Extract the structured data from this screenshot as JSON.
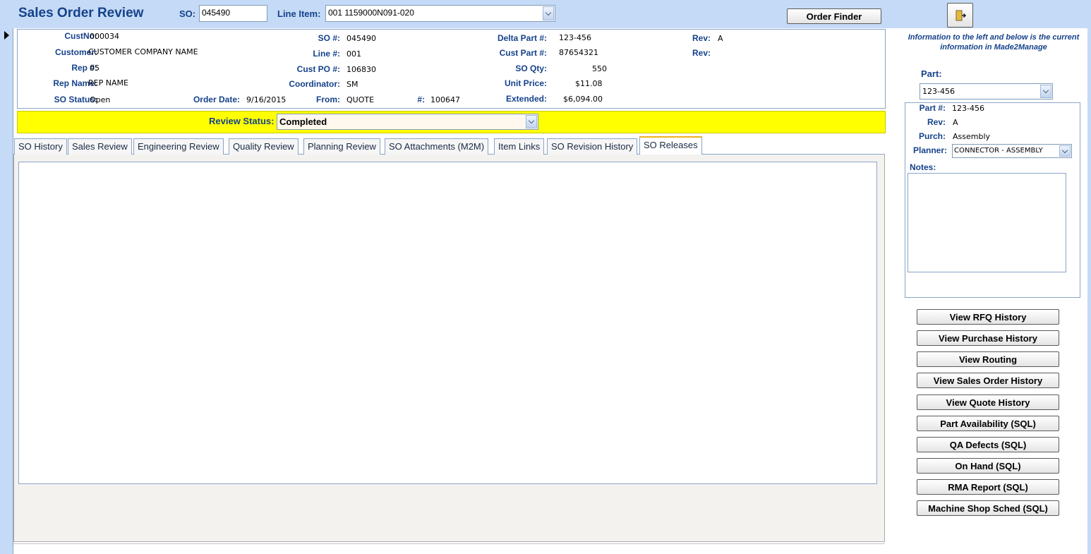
{
  "header": {
    "title": "Sales Order Review",
    "so_label": "SO:",
    "so_value": "045490",
    "line_item_label": "Line Item:",
    "line_item_value": "001 1159000N091-020",
    "order_finder_label": "Order Finder",
    "exit_icon": "exit-door-icon"
  },
  "info": {
    "custno_label": "CustNo:",
    "custno": "000034",
    "customer_label": "Customer:",
    "customer": "CUSTOMER COMPANY NAME",
    "rep_label": "Rep #:",
    "rep": "05",
    "rep_name_label": "Rep Name:",
    "rep_name": "REP NAME",
    "so_status_label": "SO Status:",
    "so_status": "Open",
    "order_date_label": "Order Date:",
    "order_date": "9/16/2015",
    "so_num_label": "SO #:",
    "so_num": "045490",
    "line_num_label": "Line #:",
    "line_num": "001",
    "cust_po_label": "Cust PO #:",
    "cust_po": "106830",
    "coordinator_label": "Coordinator:",
    "coordinator": "SM",
    "from_label": "From:",
    "from": "QUOTE",
    "from_num_label": "#:",
    "from_num": "100647",
    "delta_part_label": "Delta Part #:",
    "delta_part": "123-456",
    "cust_part_label": "Cust Part #:",
    "cust_part": "87654321",
    "so_qty_label": "SO Qty:",
    "so_qty": "550",
    "unit_price_label": "Unit Price:",
    "unit_price": "$11.08",
    "extended_label": "Extended:",
    "extended": "$6,094.00",
    "rev1_label": "Rev:",
    "rev1": "A",
    "rev2_label": "Rev:",
    "rev2": ""
  },
  "review": {
    "label": "Review Status:",
    "value": "Completed"
  },
  "tabs": [
    {
      "label": "SO History"
    },
    {
      "label": "Sales Review"
    },
    {
      "label": "Engineering Review"
    },
    {
      "label": "Quality Review"
    },
    {
      "label": "Planning Review"
    },
    {
      "label": "SO Attachments (M2M)"
    },
    {
      "label": "Item Links"
    },
    {
      "label": "SO Revision History"
    },
    {
      "label": "SO Releases"
    }
  ],
  "active_tab": "SO Releases",
  "right": {
    "note": "Information to the left and below is the current information in Made2Manage",
    "part_label": "Part:",
    "part_value": "123-456",
    "part_num_label": "Part #:",
    "part_num": "123-456",
    "rev_label": "Rev:",
    "rev": "A",
    "purch_label": "Purch:",
    "purch": "Assembly",
    "planner_label": "Planner:",
    "planner": "CONNECTOR - ASSEMBLY",
    "notes_label": "Notes:",
    "notes": ""
  },
  "buttons": [
    {
      "label": "View RFQ History"
    },
    {
      "label": "View Purchase History"
    },
    {
      "label": "View Routing"
    },
    {
      "label": "View Sales Order History"
    },
    {
      "label": "View Quote History"
    },
    {
      "label": "Part Availability (SQL)"
    },
    {
      "label": "QA Defects (SQL)"
    },
    {
      "label": "On Hand (SQL)"
    },
    {
      "label": "RMA Report  (SQL)"
    },
    {
      "label": "Machine Shop Sched (SQL)"
    }
  ],
  "colors": {
    "header_bg": "#c5daf6",
    "label_blue": "#15428b",
    "review_bar": "#ffff00",
    "active_tab_accent": "#f0b020"
  }
}
